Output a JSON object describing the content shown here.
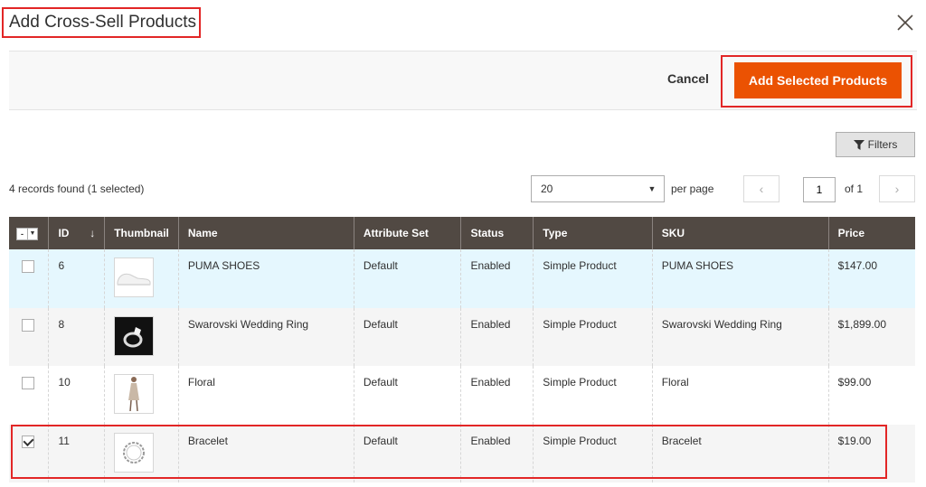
{
  "modal": {
    "title": "Add Cross-Sell Products",
    "cancel_label": "Cancel",
    "add_label": "Add Selected Products"
  },
  "toolbar": {
    "filters_label": "Filters",
    "records_text": "4 records found (1 selected)",
    "per_page_value": "20",
    "per_page_label": "per page",
    "page_value": "1",
    "page_of": "of 1"
  },
  "grid": {
    "columns": {
      "id": "ID",
      "thumbnail": "Thumbnail",
      "name": "Name",
      "attribute_set": "Attribute Set",
      "status": "Status",
      "type": "Type",
      "sku": "SKU",
      "price": "Price"
    },
    "rows": [
      {
        "checked": false,
        "id": "6",
        "thumb": "shoe-image",
        "name": "PUMA SHOES",
        "attribute_set": "Default",
        "status": "Enabled",
        "type": "Simple Product",
        "sku": "PUMA SHOES",
        "price": "$147.00"
      },
      {
        "checked": false,
        "id": "8",
        "thumb": "ring-image",
        "name": "Swarovski Wedding Ring",
        "attribute_set": "Default",
        "status": "Enabled",
        "type": "Simple Product",
        "sku": "Swarovski Wedding Ring",
        "price": "$1,899.00"
      },
      {
        "checked": false,
        "id": "10",
        "thumb": "dress-image",
        "name": "Floral",
        "attribute_set": "Default",
        "status": "Enabled",
        "type": "Simple Product",
        "sku": "Floral",
        "price": "$99.00"
      },
      {
        "checked": true,
        "id": "11",
        "thumb": "bracelet-image",
        "name": "Bracelet",
        "attribute_set": "Default",
        "status": "Enabled",
        "type": "Simple Product",
        "sku": "Bracelet",
        "price": "$19.00"
      }
    ]
  },
  "colors": {
    "primary": "#eb5202",
    "header_bg": "#514943",
    "highlight": "#e22626",
    "row_hover": "#e5f7fe"
  }
}
